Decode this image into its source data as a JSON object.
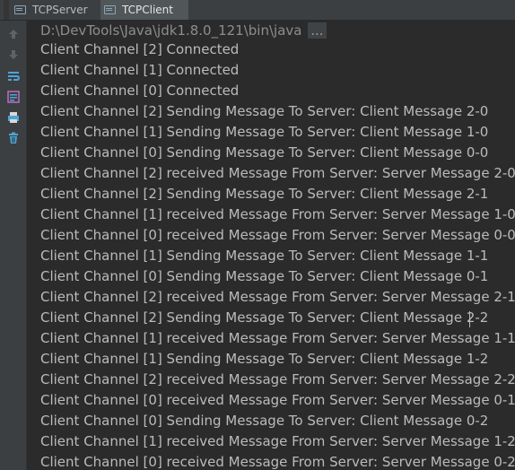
{
  "tabs": [
    {
      "label": "TCPServer"
    },
    {
      "label": "TCPClient"
    }
  ],
  "toolbar": {
    "icons": [
      "arrow-up-icon",
      "arrow-down-icon",
      "soft-wrap-icon",
      "scroll-to-end-icon",
      "print-icon",
      "trash-icon"
    ]
  },
  "console": {
    "command": "D:\\DevTools\\Java\\jdk1.8.0_121\\bin\\java",
    "command_ellipsis": "...",
    "lines": [
      "Client Channel [2] Connected",
      "Client Channel [1] Connected",
      "Client Channel [0] Connected",
      "Client Channel [2] Sending Message To Server: Client Message 2-0",
      "Client Channel [1] Sending Message To Server: Client Message 1-0",
      "Client Channel [0] Sending Message To Server: Client Message 0-0",
      "Client Channel [2] received Message From Server: Server Message 2-0",
      "Client Channel [2] Sending Message To Server: Client Message 2-1",
      "Client Channel [1] received Message From Server: Server Message 1-0",
      "Client Channel [0] received Message From Server: Server Message 0-0",
      "Client Channel [1] Sending Message To Server: Client Message 1-1",
      "Client Channel [0] Sending Message To Server: Client Message 0-1",
      "Client Channel [2] received Message From Server: Server Message 2-1",
      "Client Channel [2] Sending Message To Server: Client Message 2-2",
      "Client Channel [1] received Message From Server: Server Message 1-1",
      "Client Channel [1] Sending Message To Server: Client Message 1-2",
      "Client Channel [2] received Message From Server: Server Message 2-2",
      "Client Channel [0] received Message From Server: Server Message 0-1",
      "Client Channel [0] Sending Message To Server: Client Message 0-2",
      "Client Channel [1] received Message From Server: Server Message 1-2",
      "Client Channel [0] received Message From Server: Server Message 0-2"
    ]
  }
}
